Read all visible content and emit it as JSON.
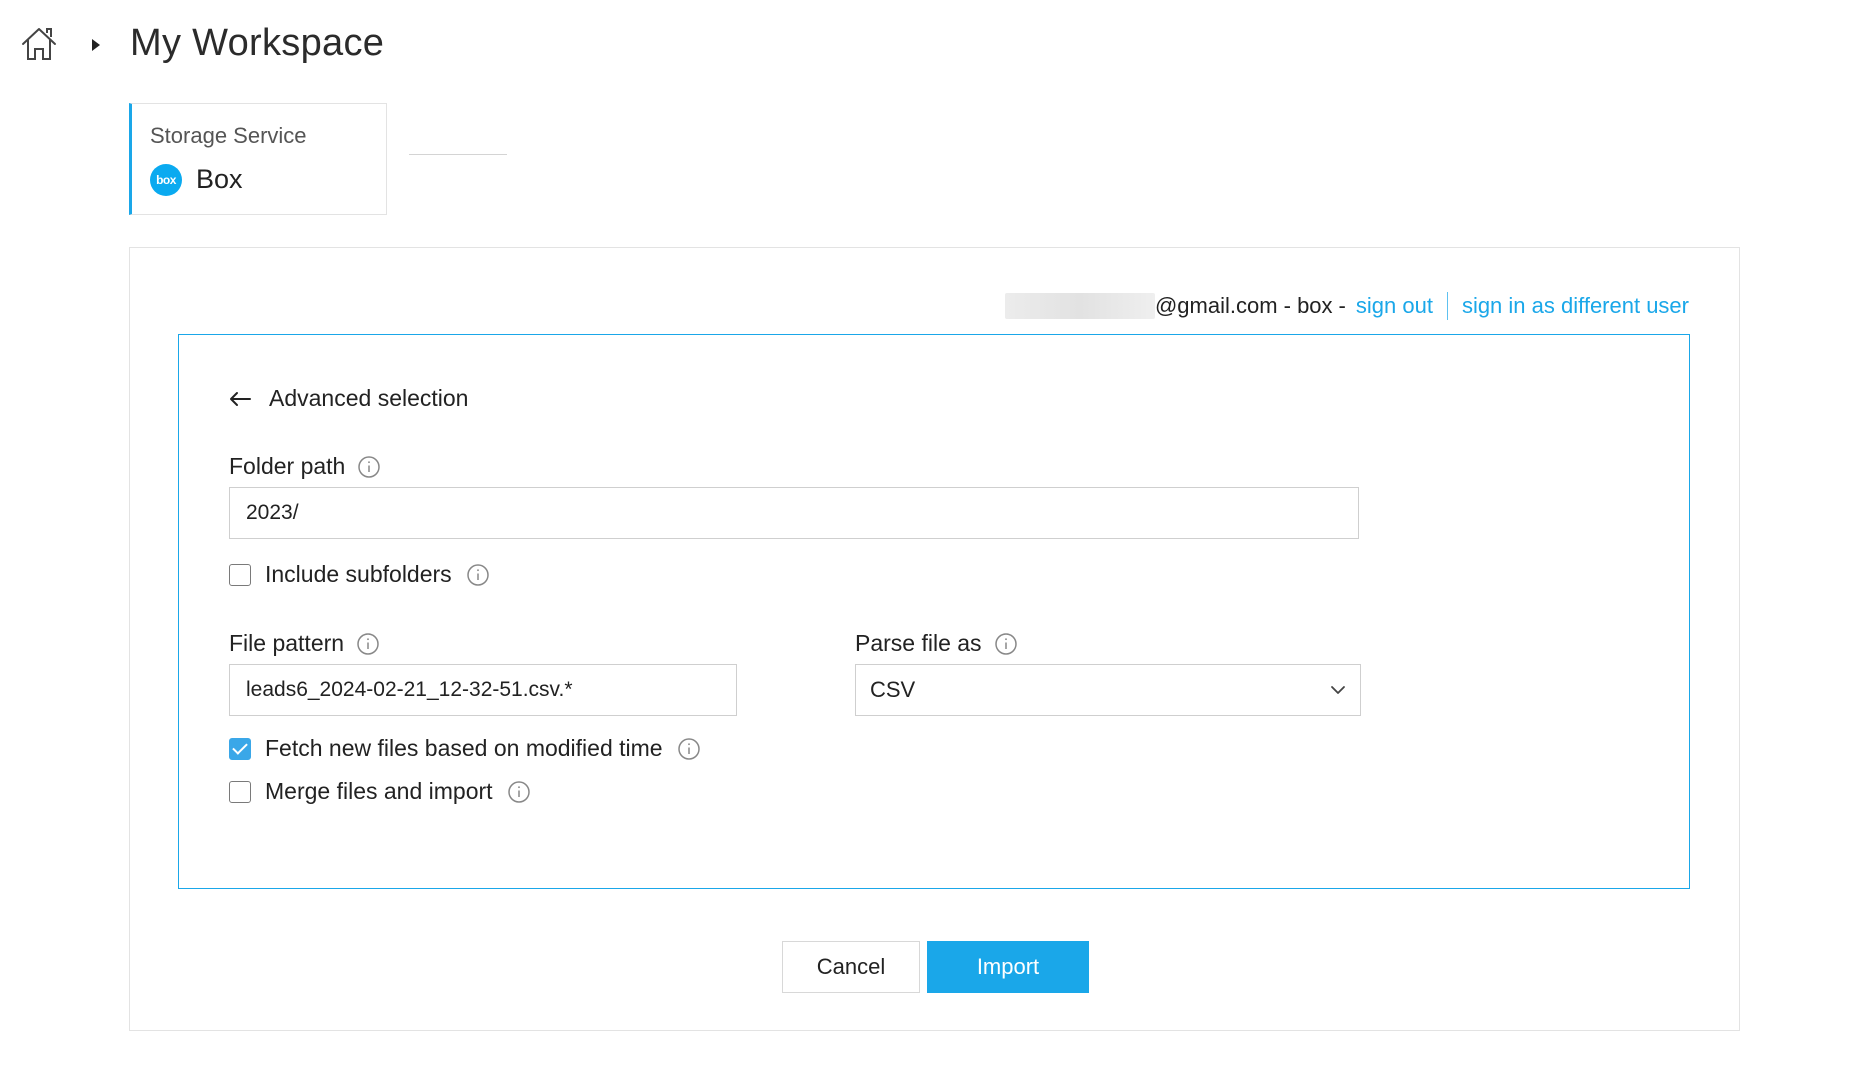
{
  "header": {
    "title": "My Workspace",
    "icons": {
      "home": "home-icon",
      "caret": "caret-right-icon"
    }
  },
  "storage_service": {
    "label": "Storage Service",
    "logo_text": "box",
    "name": "Box",
    "brand_color": "#0aaaf0"
  },
  "account": {
    "email_suffix": "@gmail.com - box",
    "separator": "-",
    "sign_out_label": "sign out",
    "sign_in_different_label": "sign in as different user"
  },
  "form": {
    "back_label": "Advanced selection",
    "folder_path": {
      "label": "Folder path",
      "value": "2023/"
    },
    "include_subfolders": {
      "label": "Include subfolders",
      "checked": false
    },
    "file_pattern": {
      "label": "File pattern",
      "value": "leads6_2024-02-21_12-32-51.csv.*"
    },
    "parse_file_as": {
      "label": "Parse file as",
      "selected": "CSV"
    },
    "fetch_new_files": {
      "label": "Fetch new files based on modified time",
      "checked": true
    },
    "merge_files": {
      "label": "Merge files and import",
      "checked": false
    }
  },
  "actions": {
    "cancel_label": "Cancel",
    "import_label": "Import"
  },
  "colors": {
    "accent": "#1aa7e9",
    "border": "#e3e3e3"
  }
}
